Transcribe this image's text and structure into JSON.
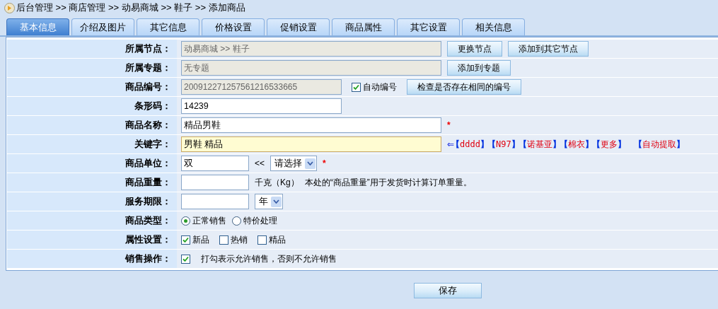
{
  "breadcrumb": "后台管理 >> 商店管理 >> 动易商城 >> 鞋子 >> 添加商品",
  "tabs": [
    {
      "label": "基本信息",
      "selected": true
    },
    {
      "label": "介绍及图片",
      "selected": false
    },
    {
      "label": "其它信息",
      "selected": false
    },
    {
      "label": "价格设置",
      "selected": false
    },
    {
      "label": "促销设置",
      "selected": false
    },
    {
      "label": "商品属性",
      "selected": false
    },
    {
      "label": "其它设置",
      "selected": false
    },
    {
      "label": "相关信息",
      "selected": false
    }
  ],
  "rows": [
    {
      "label": "所属节点：",
      "items": [
        {
          "kind": "field",
          "value": "动易商城 >> 鞋子",
          "readonly": true,
          "focused": false
        },
        {
          "kind": "button",
          "label": "更换节点"
        },
        {
          "kind": "button",
          "label": "添加到其它节点"
        }
      ]
    },
    {
      "label": "所属专题：",
      "items": [
        {
          "kind": "field",
          "value": "无专题",
          "readonly": true,
          "focused": false
        },
        {
          "kind": "button",
          "label": "添加到专题"
        }
      ]
    },
    {
      "label": "商品编号：",
      "items": [
        {
          "kind": "field",
          "value": "200912271257561216533665",
          "readonly": true,
          "focused": false
        },
        {
          "kind": "checkbox",
          "label": "自动编号",
          "checked": true
        },
        {
          "kind": "button",
          "label": "检查是否存在相同的编号"
        }
      ]
    },
    {
      "label": "条形码：",
      "items": [
        {
          "kind": "field",
          "value": "14239",
          "readonly": false,
          "focused": false
        }
      ]
    },
    {
      "label": "商品名称：",
      "items": [
        {
          "kind": "field",
          "value": "精品男鞋",
          "readonly": false,
          "focused": false
        },
        {
          "kind": "required",
          "text": "*"
        }
      ]
    },
    {
      "label": "关键字：",
      "items": [
        {
          "kind": "field",
          "value": "男鞋 精品",
          "readonly": false,
          "focused": true
        },
        {
          "kind": "arrow",
          "text": "⇐"
        },
        {
          "kind": "tag",
          "text": "【dddd】"
        },
        {
          "kind": "tag",
          "text": "【N97】"
        },
        {
          "kind": "tag",
          "text": "【诺基亚】"
        },
        {
          "kind": "tag",
          "text": "【棉衣】"
        },
        {
          "kind": "tag",
          "text": "【更多】"
        },
        {
          "kind": "tag",
          "text": "【自动提取】"
        }
      ]
    },
    {
      "label": "商品单位：",
      "items": [
        {
          "kind": "field",
          "value": "双",
          "readonly": false,
          "focused": false
        },
        {
          "kind": "note",
          "text": "<<"
        },
        {
          "kind": "select",
          "value": "请选择"
        },
        {
          "kind": "required",
          "text": "*"
        }
      ]
    },
    {
      "label": "商品重量：",
      "items": [
        {
          "kind": "field",
          "value": "",
          "readonly": false,
          "focused": false
        },
        {
          "kind": "note",
          "text": "千克（Kg）"
        },
        {
          "kind": "note",
          "text": "本处的“商品重量”用于发货时计算订单重量。"
        }
      ]
    },
    {
      "label": "服务期限：",
      "items": [
        {
          "kind": "field",
          "value": "",
          "readonly": false,
          "focused": false
        },
        {
          "kind": "select",
          "value": "年"
        }
      ]
    },
    {
      "label": "商品类型：",
      "items": [
        {
          "kind": "radio",
          "label": "正常销售",
          "selected": true
        },
        {
          "kind": "radio",
          "label": "特价处理",
          "selected": false
        }
      ]
    },
    {
      "label": "属性设置：",
      "items": [
        {
          "kind": "checkbox",
          "label": "新品",
          "checked": true
        },
        {
          "kind": "checkbox",
          "label": "热销",
          "checked": false
        },
        {
          "kind": "checkbox",
          "label": "精品",
          "checked": false
        }
      ]
    },
    {
      "label": "销售操作：",
      "items": [
        {
          "kind": "checkbox",
          "label": "打勾表示允许销售，否则不允许销售",
          "checked": true
        }
      ]
    }
  ],
  "save_button": "保存"
}
